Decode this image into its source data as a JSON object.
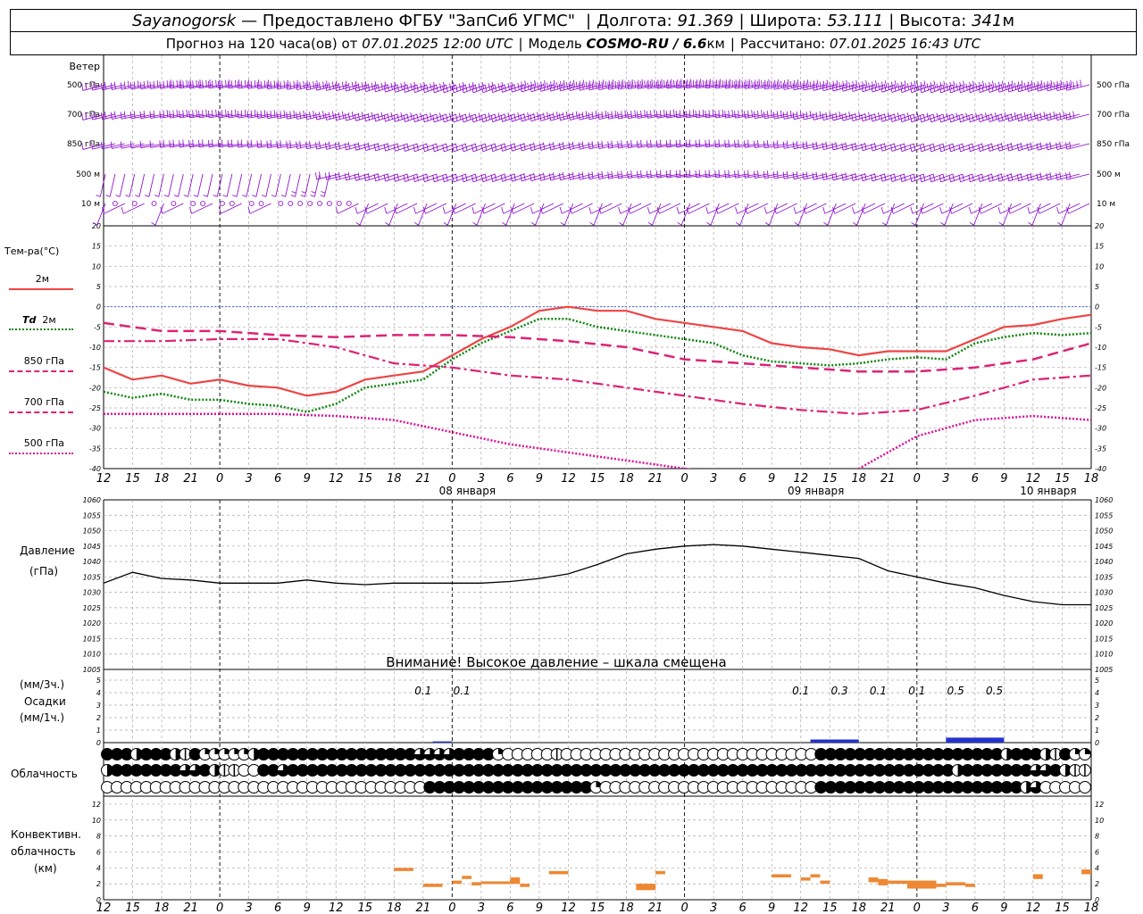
{
  "header": {
    "station": "Sayanogorsk",
    "provider": "— Предоставлено ФГБУ \"ЗапСиб УГМС\"",
    "lon_label": "Долгота:",
    "lon": "91.369",
    "lat_label": "Широта:",
    "lat": "53.111",
    "alt_label": "Высота:",
    "alt": "341",
    "alt_unit": "м",
    "fc_label": "Прогноз на 120 часа(ов) от",
    "fc_time": "07.01.2025 12:00 UTC",
    "model_label": "Модель",
    "model": "COSMO-RU / 6.6",
    "model_unit": "км",
    "calc_label": "Рассчитано:",
    "calc_time": "07.01.2025 16:43 UTC"
  },
  "labels": {
    "wind": "Ветер",
    "wind_levels": [
      "500 гПа",
      "700 гПа",
      "850 гПа",
      "500 м",
      "10 м"
    ],
    "temp": "Тем-ра(°C)",
    "t2m": "2м",
    "td": "Td",
    "td2m": "2м",
    "t850": "850 гПа",
    "t700": "700 гПа",
    "t500": "500 гПа",
    "pressure": "Давление",
    "pressure_unit": "(гПа)",
    "precip_u1": "(мм/3ч.)",
    "precip": "Осадки",
    "precip_u2": "(мм/1ч.)",
    "cloud": "Облачность",
    "conv1": "Конвективн.",
    "conv2": "облачность",
    "conv3": "(км)",
    "warning": "Внимание! Высокое давление – шкала смещена"
  },
  "colors": {
    "t2m": "#ee4444",
    "td": "#118811",
    "t850": "#dd2277",
    "t700": "#dd2277",
    "t500": "#dd1199",
    "wind": "#8800cc",
    "precip": "#2233cc",
    "conv": "#ee8833",
    "zero_line": "#4466dd"
  },
  "chart_data": {
    "type": "line",
    "x_hours": "forecast hour offset from 07.01.2025 12:00 UTC, 0..102",
    "time_tick_labels": [
      "12",
      "15",
      "18",
      "21",
      "0",
      "3",
      "6",
      "9",
      "12",
      "15",
      "18",
      "21",
      "0",
      "3",
      "6",
      "9",
      "12",
      "15",
      "18",
      "21",
      "0",
      "3",
      "6",
      "9",
      "12",
      "15",
      "18",
      "21",
      "0",
      "3",
      "6",
      "9",
      "12",
      "15",
      "18"
    ],
    "date_labels": [
      "08 января",
      "09 января",
      "10 января"
    ],
    "temperature": {
      "ylim": [
        -40,
        20
      ],
      "yticks": [
        20,
        15,
        10,
        5,
        0,
        -5,
        -10,
        -15,
        -20,
        -25,
        -30,
        -35,
        -40
      ],
      "series": [
        {
          "key": "t2m",
          "x": [
            0,
            3,
            6,
            9,
            12,
            15,
            18,
            21,
            24,
            27,
            30,
            33,
            36,
            39,
            42,
            45,
            48,
            51,
            54,
            57,
            60,
            63,
            66,
            69,
            72,
            75,
            78,
            81,
            84,
            87,
            90,
            93,
            96,
            99,
            102
          ],
          "values": [
            -15,
            -18,
            -17,
            -19,
            -18,
            -19.5,
            -20,
            -22,
            -21,
            -18,
            -17,
            -16,
            -12,
            -8,
            -5,
            -1,
            0,
            -1,
            -1,
            -3,
            -4,
            -5,
            -6,
            -9,
            -10,
            -10.5,
            -12,
            -11,
            -11,
            -11,
            -8,
            -5,
            -4.5,
            -3,
            -2
          ]
        },
        {
          "key": "td",
          "x": [
            0,
            3,
            6,
            9,
            12,
            15,
            18,
            21,
            24,
            27,
            30,
            33,
            36,
            39,
            42,
            45,
            48,
            51,
            54,
            57,
            60,
            63,
            66,
            69,
            72,
            75,
            78,
            81,
            84,
            87,
            90,
            93,
            96,
            99,
            102
          ],
          "values": [
            -21,
            -22.5,
            -21.5,
            -23,
            -23,
            -24,
            -24.5,
            -26,
            -24,
            -20,
            -19,
            -18,
            -13,
            -9,
            -6,
            -3,
            -3,
            -5,
            -6,
            -7,
            -8,
            -9,
            -12,
            -13.5,
            -14,
            -14.5,
            -14,
            -13,
            -12.5,
            -13,
            -9,
            -7.5,
            -6.5,
            -7,
            -6.5
          ]
        },
        {
          "key": "t850",
          "x": [
            0,
            6,
            12,
            18,
            24,
            30,
            36,
            42,
            48,
            54,
            60,
            66,
            72,
            78,
            84,
            90,
            96,
            102
          ],
          "values": [
            -4,
            -6,
            -6,
            -7,
            -7.5,
            -7,
            -7,
            -7.5,
            -8.5,
            -10,
            -13,
            -14,
            -15,
            -16,
            -16,
            -15,
            -13,
            -9
          ]
        },
        {
          "key": "t700",
          "x": [
            0,
            6,
            12,
            18,
            24,
            30,
            36,
            42,
            48,
            54,
            60,
            66,
            72,
            78,
            84,
            90,
            96,
            102
          ],
          "values": [
            -8.5,
            -8.5,
            -8,
            -8,
            -10,
            -14,
            -15,
            -17,
            -18,
            -20,
            -22,
            -24,
            -25.5,
            -26.5,
            -25.5,
            -22,
            -18,
            -17
          ]
        },
        {
          "key": "t500",
          "x": [
            0,
            6,
            12,
            18,
            24,
            30,
            36,
            42,
            48,
            54,
            60,
            66,
            72,
            78,
            84,
            90,
            96,
            102
          ],
          "values": [
            -26.5,
            -26.5,
            -26.5,
            -26.5,
            -27,
            -28,
            -31,
            -34,
            -36,
            -38,
            -40,
            -42,
            -45,
            -40,
            -32,
            -28,
            -27,
            -28
          ]
        }
      ]
    },
    "pressure": {
      "ylim": [
        1005,
        1060
      ],
      "yticks": [
        1060,
        1055,
        1050,
        1045,
        1040,
        1035,
        1030,
        1025,
        1020,
        1015,
        1010,
        1005
      ],
      "x": [
        0,
        3,
        6,
        9,
        12,
        15,
        18,
        21,
        24,
        27,
        30,
        33,
        36,
        39,
        42,
        45,
        48,
        51,
        54,
        57,
        60,
        63,
        66,
        69,
        72,
        75,
        78,
        81,
        84,
        87,
        90,
        93,
        96,
        99,
        102
      ],
      "values": [
        1033,
        1036.5,
        1034.5,
        1034,
        1033,
        1033,
        1033,
        1034,
        1033,
        1032.5,
        1033,
        1033,
        1033,
        1033,
        1033.5,
        1034.5,
        1036,
        1039,
        1042.5,
        1044,
        1045,
        1045.5,
        1045,
        1044,
        1043,
        1042,
        1041,
        1037,
        1035,
        1033,
        1031.5,
        1029,
        1027,
        1026,
        1026
      ]
    },
    "precipitation": {
      "ylim": [
        0,
        5
      ],
      "yticks": [
        5,
        4,
        3,
        2,
        1,
        0
      ],
      "totals_3h": [
        {
          "x": 33,
          "label": "0.1"
        },
        {
          "x": 37,
          "label": "0.1"
        },
        {
          "x": 72,
          "label": "0.1"
        },
        {
          "x": 76,
          "label": "0.3"
        },
        {
          "x": 80,
          "label": "0.1"
        },
        {
          "x": 84,
          "label": "0.1"
        },
        {
          "x": 88,
          "label": "0.5"
        },
        {
          "x": 92,
          "label": "0.5"
        }
      ],
      "bars": [
        {
          "x0": 34,
          "x1": 36,
          "v": 0.1
        },
        {
          "x0": 73,
          "x1": 78,
          "v": 0.25
        },
        {
          "x0": 87,
          "x1": 93,
          "v": 0.4
        }
      ]
    },
    "clouds": {
      "rows": [
        "FFFHFFFHVFQQQQQHFFFFFFFFFFFFFFFFTTTTFFFFQOOOOOVOOOOOOOOOOOOOOOOOOOOOOOOOOFFFFFFFFFFFFFFFF",
        "HFFFFFFFTTFHVVOOFFTFFFFFFFFFFFFFFFFFFFFFFFFFFFFFFFFFFFFFFFFFFFFFFFFFFFFFFFFFFFFFFFFFFFF",
        "OOOOOOOOOOOOOOOOOOOOOOOOOOOOOOOOOFFFFFFFFFFFFFFFFFQOOOOOOOOOOOOOOOOOOOOOOFFFFFFFFFFFFFFFFFFFFFHTOOOOOO"
      ]
    },
    "convective": {
      "ylim": [
        0,
        13
      ],
      "yticks": [
        12,
        10,
        8,
        6,
        4,
        2,
        0
      ],
      "segments": [
        {
          "x0": 30,
          "x1": 32,
          "lo": 3.6,
          "hi": 4
        },
        {
          "x0": 33,
          "x1": 35,
          "lo": 1.6,
          "hi": 2
        },
        {
          "x0": 36,
          "x1": 37,
          "lo": 2,
          "hi": 2.4
        },
        {
          "x0": 37,
          "x1": 38,
          "lo": 2.6,
          "hi": 3
        },
        {
          "x0": 38,
          "x1": 39,
          "lo": 1.8,
          "hi": 2.2
        },
        {
          "x0": 39,
          "x1": 42,
          "lo": 2,
          "hi": 2.3
        },
        {
          "x0": 42,
          "x1": 43,
          "lo": 2,
          "hi": 2.8
        },
        {
          "x0": 43,
          "x1": 44,
          "lo": 1.6,
          "hi": 2
        },
        {
          "x0": 46,
          "x1": 48,
          "lo": 3.2,
          "hi": 3.6
        },
        {
          "x0": 55,
          "x1": 57,
          "lo": 1.2,
          "hi": 2
        },
        {
          "x0": 57,
          "x1": 58,
          "lo": 3.2,
          "hi": 3.6
        },
        {
          "x0": 69,
          "x1": 71,
          "lo": 2.8,
          "hi": 3.2
        },
        {
          "x0": 72,
          "x1": 73,
          "lo": 2.4,
          "hi": 2.8
        },
        {
          "x0": 73,
          "x1": 74,
          "lo": 2.8,
          "hi": 3.2
        },
        {
          "x0": 74,
          "x1": 75,
          "lo": 2.0,
          "hi": 2.4
        },
        {
          "x0": 79,
          "x1": 80,
          "lo": 2.2,
          "hi": 2.8
        },
        {
          "x0": 80,
          "x1": 81,
          "lo": 1.8,
          "hi": 2.6
        },
        {
          "x0": 81,
          "x1": 83,
          "lo": 2.0,
          "hi": 2.4
        },
        {
          "x0": 83,
          "x1": 86,
          "lo": 1.4,
          "hi": 2.4
        },
        {
          "x0": 86,
          "x1": 87,
          "lo": 1.6,
          "hi": 2.0
        },
        {
          "x0": 87,
          "x1": 89,
          "lo": 1.8,
          "hi": 2.2
        },
        {
          "x0": 89,
          "x1": 90,
          "lo": 1.6,
          "hi": 2.0
        },
        {
          "x0": 96,
          "x1": 97,
          "lo": 2.6,
          "hi": 3.2
        },
        {
          "x0": 101,
          "x1": 102,
          "lo": 3.2,
          "hi": 3.8
        }
      ]
    },
    "wind": {
      "levels": [
        "500 гПа",
        "700 гПа",
        "850 гПа",
        "500 м",
        "10 м"
      ],
      "strength": [
        [
          2,
          2,
          2,
          2,
          3,
          3,
          3,
          3,
          4,
          4,
          4,
          4,
          4,
          4,
          4,
          4,
          4,
          4,
          4,
          4,
          4,
          4,
          4,
          4,
          4,
          4,
          4,
          4,
          4,
          4,
          4,
          4,
          4,
          4,
          4,
          4,
          4,
          4,
          4,
          4,
          4,
          4,
          4,
          4,
          5,
          5,
          5,
          5,
          5,
          5,
          5,
          5,
          5,
          5,
          5,
          5,
          5,
          5,
          5,
          5,
          5,
          5,
          5,
          5,
          5,
          5,
          5,
          5,
          5,
          5,
          5,
          5,
          5,
          5,
          5,
          5,
          5,
          5,
          5,
          5,
          5,
          5,
          5,
          5,
          5,
          5,
          5,
          5,
          5,
          5,
          5,
          5,
          5,
          5,
          5,
          5,
          5,
          5,
          5,
          5,
          5,
          5
        ],
        [
          2,
          2,
          2,
          2,
          2,
          2,
          2,
          2,
          3,
          3,
          3,
          3,
          3,
          3,
          3,
          3,
          3,
          3,
          3,
          3,
          3,
          3,
          3,
          3,
          3,
          3,
          3,
          3,
          3,
          3,
          3,
          3,
          3,
          3,
          3,
          3,
          3,
          3,
          3,
          3,
          3,
          3,
          3,
          3,
          3,
          3,
          3,
          3,
          3,
          3,
          3,
          3,
          3,
          3,
          3,
          3,
          3,
          3,
          3,
          3,
          3,
          3,
          3,
          3,
          3,
          3,
          3,
          3,
          3,
          3,
          3,
          3,
          3,
          3,
          3,
          3,
          3,
          3,
          3,
          3,
          3,
          3,
          3,
          3,
          3,
          3,
          3,
          3,
          3,
          3,
          3,
          3,
          3,
          3,
          3,
          3,
          3,
          3,
          3,
          3,
          3,
          3
        ],
        [
          1,
          1,
          1,
          1,
          1,
          1,
          1,
          1,
          2,
          2,
          2,
          2,
          2,
          2,
          2,
          2,
          2,
          2,
          2,
          2,
          2,
          2,
          2,
          2,
          2,
          2,
          2,
          2,
          2,
          2,
          2,
          2,
          2,
          2,
          2,
          2,
          2,
          2,
          2,
          2,
          2,
          2,
          2,
          2,
          2,
          2,
          2,
          2,
          2,
          2,
          2,
          2,
          2,
          2,
          2,
          2,
          2,
          2,
          2,
          2,
          2,
          2,
          2,
          2,
          2,
          2,
          2,
          2,
          2,
          2,
          2,
          2,
          2,
          2,
          2,
          2,
          2,
          2,
          2,
          2,
          2,
          2,
          2,
          2,
          2,
          2,
          2,
          2,
          2,
          2,
          2,
          2,
          2,
          2,
          2,
          2,
          2,
          2,
          2,
          2,
          2,
          2
        ],
        [
          1,
          1,
          1,
          1,
          1,
          1,
          1,
          1,
          1,
          1,
          1,
          1,
          1,
          1,
          1,
          1,
          1,
          1,
          1,
          1,
          2,
          2,
          2,
          2,
          2,
          2,
          2,
          2,
          2,
          2,
          2,
          2,
          2,
          2,
          2,
          2,
          2,
          2,
          2,
          2,
          2,
          2,
          2,
          2,
          2,
          2,
          2,
          2,
          2,
          2,
          2,
          2,
          2,
          2,
          2,
          2,
          2,
          2,
          2,
          2,
          2,
          2,
          2,
          2,
          2,
          2,
          2,
          2,
          2,
          2,
          2,
          2,
          2,
          2,
          2,
          2,
          2,
          2,
          2,
          2,
          2,
          2,
          2,
          2,
          2,
          2,
          2,
          2,
          2,
          2,
          2,
          2,
          2,
          2,
          2,
          2,
          2,
          2,
          2,
          2,
          2,
          2
        ],
        [
          1,
          0,
          1,
          0,
          1,
          0,
          1,
          0,
          1,
          0,
          0,
          1,
          0,
          0,
          1,
          0,
          0,
          1,
          0,
          0,
          0,
          0,
          0,
          0,
          0,
          0,
          1,
          1,
          1,
          1,
          1,
          1,
          1,
          1,
          1,
          1,
          1,
          1,
          1,
          1,
          1,
          1,
          1,
          1,
          1,
          1,
          1,
          1,
          1,
          1,
          1,
          1,
          1,
          1,
          1,
          1,
          1,
          1,
          1,
          1,
          1,
          1,
          1,
          1,
          1,
          1,
          1,
          1,
          1,
          1,
          1,
          1,
          1,
          1,
          1,
          1,
          1,
          1,
          1,
          1,
          1,
          1,
          1,
          1,
          1,
          1,
          1,
          1,
          1,
          1,
          1,
          1,
          1,
          1,
          1,
          1,
          1,
          1,
          1,
          1,
          1,
          1
        ]
      ]
    }
  }
}
